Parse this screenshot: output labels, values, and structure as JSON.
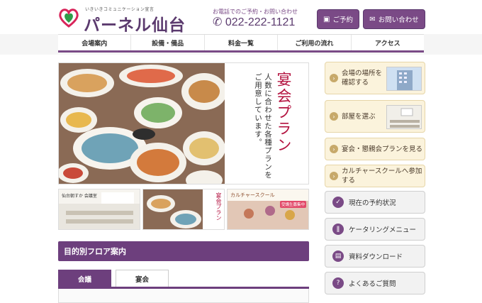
{
  "header": {
    "logo_tagline": "いきいきコミュニケーション宣言",
    "logo_name": "パーネル仙台",
    "phone_label": "お電話でのご予約・お問い合わせ",
    "phone_number": "022-222-1121",
    "reserve_label": "ご予約",
    "contact_label": "お問い合わせ"
  },
  "nav": {
    "items": [
      "会場案内",
      "設備・備品",
      "料金一覧",
      "ご利用の流れ",
      "アクセス"
    ]
  },
  "hero": {
    "title": "宴会プラン",
    "subtitle_line1": "人数に合わせた各種プランを",
    "subtitle_line2": "ご用意しています。"
  },
  "thumbs": {
    "t1_label": "仙台朝すか 会議室",
    "t2_label": "宴会プラン",
    "t3_label": "カルチャースクール",
    "t3_badge": "受講生募集中"
  },
  "floor": {
    "title": "目的別フロア案内",
    "tabs": [
      "会議",
      "宴会"
    ]
  },
  "side": {
    "find_venue": "会場の場所を確認する",
    "choose_room": "部屋を選ぶ",
    "banquet_plan": "宴会・懇親会プランを見る",
    "culture": "カルチャースクールへ参加する",
    "reservation_status": "現在の予約状況",
    "catering": "ケータリングメニュー",
    "download": "資料ダウンロード",
    "faq": "よくあるご質問"
  },
  "colors": {
    "brand_purple": "#6d3f7d",
    "accent_red": "#b3123f",
    "side_cream": "#fbf3dc"
  }
}
